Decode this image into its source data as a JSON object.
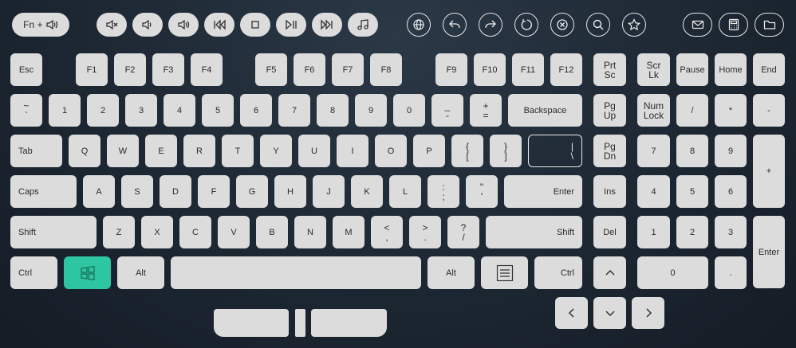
{
  "top_bar": {
    "fn_label": "Fn +",
    "media": [
      "mute-icon",
      "volume-down-icon",
      "volume-up-icon",
      "previous-track-icon",
      "stop-icon",
      "play-pause-icon",
      "next-track-icon",
      "music-icon"
    ],
    "browser": [
      "globe-icon",
      "back-icon",
      "forward-icon",
      "refresh-icon",
      "close-icon",
      "search-icon",
      "star-icon"
    ],
    "apps": [
      "mail-icon",
      "calculator-icon",
      "folder-icon"
    ]
  },
  "keys": {
    "esc": "Esc",
    "f1": "F1",
    "f2": "F2",
    "f3": "F3",
    "f4": "F4",
    "f5": "F5",
    "f6": "F6",
    "f7": "F7",
    "f8": "F8",
    "f9": "F9",
    "f10": "F10",
    "f11": "F11",
    "f12": "F12",
    "prtsc": [
      "Prt",
      "Sc"
    ],
    "scrlk": [
      "Scr",
      "Lk"
    ],
    "pause": "Pause",
    "home": "Home",
    "end": "End",
    "tilde": [
      "~",
      "`"
    ],
    "n1": "1",
    "n2": "2",
    "n3": "3",
    "n4": "4",
    "n5": "5",
    "n6": "6",
    "n7": "7",
    "n8": "8",
    "n9": "9",
    "n0": "0",
    "minus": [
      "_",
      "-"
    ],
    "equal": [
      "+",
      "="
    ],
    "backspace": "Backspace",
    "pgup": [
      "Pg",
      "Up"
    ],
    "numlock": [
      "Num",
      "Lock"
    ],
    "np_div": "/",
    "np_mul": "*",
    "np_sub": "-",
    "tab": "Tab",
    "q": "Q",
    "w": "W",
    "e": "E",
    "r": "R",
    "t": "T",
    "y": "Y",
    "u": "U",
    "i": "I",
    "o": "O",
    "p": "P",
    "lbrace": [
      "{",
      "["
    ],
    "rbrace": [
      "}",
      "]"
    ],
    "pipe": [
      "|",
      "\\"
    ],
    "pgdn": [
      "Pg",
      "Dn"
    ],
    "np7": "7",
    "np8": "8",
    "np9": "9",
    "np_add": "+",
    "caps": "Caps",
    "a": "A",
    "s": "S",
    "d": "D",
    "f": "F",
    "g": "G",
    "h": "H",
    "j": "J",
    "k": "K",
    "l": "L",
    "colon": [
      ":",
      ";"
    ],
    "quote": [
      "\"",
      "'"
    ],
    "enter": "Enter",
    "ins": "Ins",
    "np4": "4",
    "np5": "5",
    "np6": "6",
    "lshift": "Shift",
    "z": "Z",
    "x": "X",
    "c": "C",
    "v": "V",
    "b": "B",
    "n": "N",
    "m": "M",
    "lt": [
      "<",
      ","
    ],
    "gt": [
      ">",
      "."
    ],
    "question": [
      "?",
      "/"
    ],
    "rshift": "Shift",
    "del": "Del",
    "np1": "1",
    "np2": "2",
    "np3": "3",
    "np_enter": "Enter",
    "lctrl": "Ctrl",
    "lalt": "Alt",
    "ralt": "Alt",
    "rctrl": "Ctrl",
    "np0": "0",
    "np_dot": "."
  },
  "colors": {
    "accent": "#2dc6a0",
    "key": "#dcdcdc",
    "background": "#1f2a36"
  }
}
